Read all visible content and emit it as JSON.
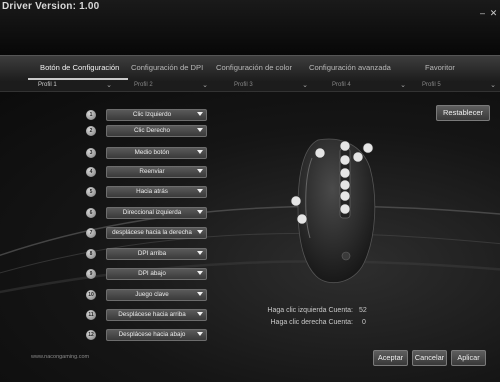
{
  "window": {
    "title": "Driver Version: 1.00",
    "minimize_icon": "minimize-icon",
    "close_icon": "close-icon"
  },
  "tabs": [
    {
      "label": "Botón de Configuración",
      "active": true
    },
    {
      "label": "Configuración de DPI",
      "active": false
    },
    {
      "label": "Configuración de color",
      "active": false
    },
    {
      "label": "Configuración avanzada",
      "active": false
    },
    {
      "label": "Favoritor",
      "active": false
    }
  ],
  "profiles": [
    {
      "label": "Profil 1",
      "active": true
    },
    {
      "label": "Profil 2",
      "active": false
    },
    {
      "label": "Profil 3",
      "active": false
    },
    {
      "label": "Profil 4",
      "active": false
    },
    {
      "label": "Profil 5",
      "active": false
    }
  ],
  "buttons": [
    {
      "num": "1",
      "value": "Clic Izquierdo"
    },
    {
      "num": "2",
      "value": "Clic Derecho"
    },
    {
      "num": "3",
      "value": "Medio botón"
    },
    {
      "num": "4",
      "value": "Reenviar"
    },
    {
      "num": "5",
      "value": "Hacia atrás"
    },
    {
      "num": "6",
      "value": "Direccional izquierda"
    },
    {
      "num": "7",
      "value": "desplácese hacia la derecha"
    },
    {
      "num": "8",
      "value": "DPI arriba"
    },
    {
      "num": "9",
      "value": "DPI abajo"
    },
    {
      "num": "10",
      "value": "Juego clave"
    },
    {
      "num": "11",
      "value": "Desplácese hacia arriba"
    },
    {
      "num": "12",
      "value": "Desplácese hacia abajo"
    }
  ],
  "reset_label": "Restablecer",
  "stats": {
    "left_label": "Haga clic izquierda Cuenta:",
    "left_value": "52",
    "right_label": "Haga clic derecha Cuenta:",
    "right_value": "0"
  },
  "website": "www.nacongaming.com",
  "footer": {
    "accept": "Aceptar",
    "cancel": "Cancelar",
    "apply": "Aplicar"
  }
}
